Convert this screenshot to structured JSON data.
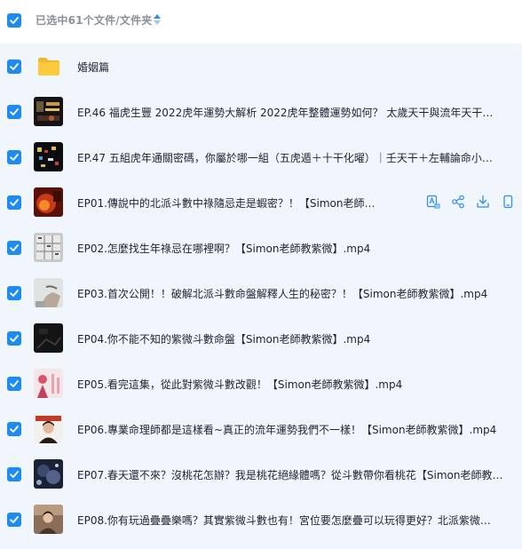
{
  "header": {
    "title": "已选中61个文件/文件夹"
  },
  "rows": [
    {
      "name": "婚姻篇",
      "type": "folder"
    },
    {
      "name": "EP.46 福虎生豐 2022虎年運勢大解析 2022虎年整體運勢如何？ 太歲天干與流年天干…",
      "type": "video",
      "thumb": "dark-stage"
    },
    {
      "name": "EP.47 五組虎年通關密碼，你屬於哪一組（五虎遁＋十干化曜）｜壬天干＋左輔論命小…",
      "type": "video",
      "thumb": "dark-lights"
    },
    {
      "name": "EP01.傳說中的北派斗數中祿隨忌走是蝦密？！【Simon老師…",
      "type": "video",
      "thumb": "red-fire"
    },
    {
      "name": "EP02.怎麼找生年祿忌在哪裡啊？【Simon老師教紫微】.mp4",
      "type": "video",
      "thumb": "grey-grid"
    },
    {
      "name": "EP03.首次公開！！破解北派斗數命盤解釋人生的秘密？！【Simon老師教紫微】.mp4",
      "type": "video",
      "thumb": "light-hand"
    },
    {
      "name": "EP04.你不能不知的紫微斗數命盤【Simon老師教紫微】.mp4",
      "type": "video",
      "thumb": "dark-plain"
    },
    {
      "name": "EP05.看完這集，從此對紫微斗數改觀！【Simon老師教紫微】.mp4",
      "type": "video",
      "thumb": "pink-figure"
    },
    {
      "name": "EP06.專業命理師都是這樣看~真正的流年運勢我們不一樣！【Simon老師教紫微】.mp4",
      "type": "video",
      "thumb": "person-red"
    },
    {
      "name": "EP07.春天還不來？沒桃花怎辦？我是桃花絕緣體嗎？從斗數帶你看桃花【Simon老師教…",
      "type": "video",
      "thumb": "night-blue"
    },
    {
      "name": "EP08.你有玩過疊疊樂嗎？其實紫微斗數也有！宮位要怎麼疊可以玩得更好？北派紫微…",
      "type": "video",
      "thumb": "person-indoor"
    }
  ],
  "hover_actions": [
    "translate-icon",
    "share-icon",
    "download-icon",
    "phone-icon"
  ],
  "colors": {
    "accent": "#1d8bf1",
    "list_bg": "#f1f6fd",
    "folder": "#fcc93f"
  }
}
